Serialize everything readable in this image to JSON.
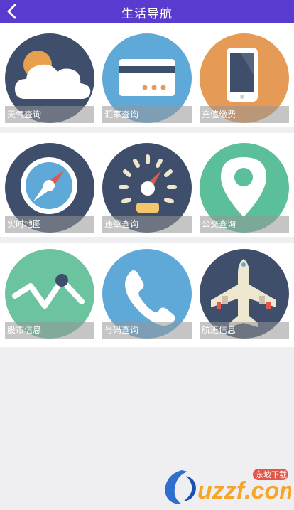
{
  "header": {
    "title": "生活导航"
  },
  "rows": [
    {
      "tiles": [
        {
          "label": "天气查询",
          "icon": "weather-cloud-sun-icon",
          "color": "#3f4f6b"
        },
        {
          "label": "汇率查询",
          "icon": "credit-card-icon",
          "color": "#5fa9d9"
        },
        {
          "label": "充值缴费",
          "icon": "smartphone-icon",
          "color": "#e59a56"
        }
      ]
    },
    {
      "tiles": [
        {
          "label": "实时地图",
          "icon": "compass-icon",
          "color": "#3f4f6b"
        },
        {
          "label": "违章查询",
          "icon": "speedometer-icon",
          "color": "#3f4f6b"
        },
        {
          "label": "公交查询",
          "icon": "map-pin-icon",
          "color": "#5bbf9a"
        }
      ]
    },
    {
      "tiles": [
        {
          "label": "股市信息",
          "icon": "stock-line-icon",
          "color": "#6cc3a0"
        },
        {
          "label": "号码查询",
          "icon": "phone-handset-icon",
          "color": "#5fa9d9"
        },
        {
          "label": "航班信息",
          "icon": "airplane-icon",
          "color": "#3f4f6b"
        }
      ]
    }
  ],
  "watermark": {
    "site": "uzzf.com",
    "tag": "东坡下载"
  }
}
